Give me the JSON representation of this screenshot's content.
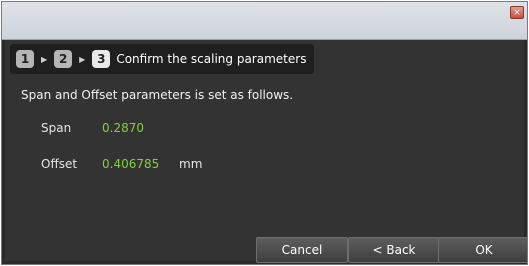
{
  "window": {
    "close_glyph": "×"
  },
  "breadcrumb": {
    "steps": [
      "1",
      "2",
      "3"
    ],
    "arrow_glyph": "▶",
    "title": "Confirm the scaling parameters"
  },
  "body": {
    "intro": "Span and Offset parameters is set as follows.",
    "span": {
      "label": "Span",
      "value": "0.2870"
    },
    "offset": {
      "label": "Offset",
      "value": "0.406785",
      "unit": "mm"
    }
  },
  "buttons": {
    "cancel": "Cancel",
    "back": "< Back",
    "ok": "OK"
  },
  "colors": {
    "value_green": "#7fd23a",
    "panel": "#333333"
  }
}
